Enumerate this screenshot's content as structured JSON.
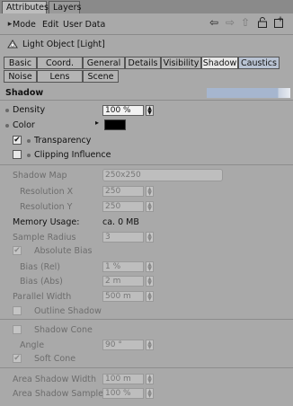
{
  "panel_tabs": [
    {
      "label": "Attributes",
      "active": true
    },
    {
      "label": "Layers",
      "active": false
    }
  ],
  "menu": {
    "mode": "Mode",
    "edit": "Edit",
    "user_data": "User Data"
  },
  "object_title": "Light Object [Light]",
  "sub_tabs": {
    "row1": [
      "Basic",
      "Coord.",
      "General",
      "Details",
      "Visibility",
      "Shadow",
      "Caustics"
    ],
    "row2": [
      "Noise",
      "Lens",
      "Scene"
    ],
    "active": "Shadow"
  },
  "section_title": "Shadow",
  "density": {
    "label": "Density",
    "value": "100 %"
  },
  "color": {
    "label": "Color",
    "swatch": "#000000"
  },
  "transparency": {
    "label": "Transparency",
    "checked": true
  },
  "clipping": {
    "label": "Clipping Influence",
    "checked": false
  },
  "shadow_map": {
    "label": "Shadow Map",
    "value": "250x250"
  },
  "resolution_x": {
    "label": "Resolution X",
    "value": "250"
  },
  "resolution_y": {
    "label": "Resolution Y",
    "value": "250"
  },
  "memory": {
    "label": "Memory Usage:",
    "value": "ca. 0 MB"
  },
  "sample_radius": {
    "label": "Sample Radius",
    "value": "3"
  },
  "absolute_bias": {
    "label": "Absolute Bias",
    "checked": true
  },
  "bias_rel": {
    "label": "Bias (Rel)",
    "value": "1 %"
  },
  "bias_abs": {
    "label": "Bias (Abs)",
    "value": "2 m"
  },
  "parallel_width": {
    "label": "Parallel Width",
    "value": "500 m"
  },
  "outline_shadow": {
    "label": "Outline Shadow",
    "checked": false
  },
  "shadow_cone": {
    "label": "Shadow Cone",
    "checked": false
  },
  "angle": {
    "label": "Angle",
    "value": "90 °"
  },
  "soft_cone": {
    "label": "Soft Cone",
    "checked": true
  },
  "area_width": {
    "label": "Area Shadow Width",
    "value": "100 m"
  },
  "area_samples": {
    "label": "Area Shadow Samples",
    "value": "100 %"
  },
  "icons": [
    "light-object-icon",
    "back-arrow-icon",
    "forward-arrow-icon",
    "up-arrow-icon",
    "lock-icon",
    "new-panel-icon"
  ],
  "colors": {
    "background": "#a9a9a9",
    "active_tab": "#e8e8e8",
    "section_bar": "#a6b6cf"
  }
}
